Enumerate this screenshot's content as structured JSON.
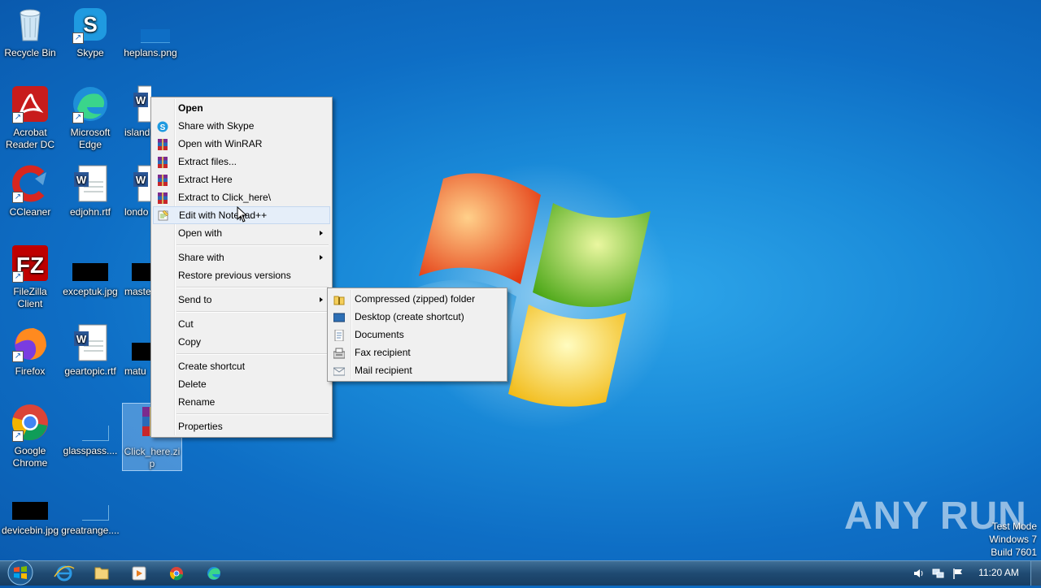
{
  "desktop": {
    "icons": [
      {
        "label": "Recycle Bin",
        "icon": "recycle-bin-icon"
      },
      {
        "label": "Skype",
        "icon": "skype-icon"
      },
      {
        "label": "heplans.png",
        "icon": "image-file-icon"
      },
      {
        "label": "Acrobat Reader DC",
        "icon": "acrobat-icon"
      },
      {
        "label": "Microsoft Edge",
        "icon": "edge-icon"
      },
      {
        "label": "island",
        "icon": "word-document-icon"
      },
      {
        "label": "CCleaner",
        "icon": "ccleaner-icon"
      },
      {
        "label": "edjohn.rtf",
        "icon": "word-document-icon"
      },
      {
        "label": "londo",
        "icon": "word-document-icon"
      },
      {
        "label": "FileZilla Client",
        "icon": "filezilla-icon"
      },
      {
        "label": "exceptuk.jpg",
        "icon": "image-file-icon"
      },
      {
        "label": "maste",
        "icon": "image-file-icon"
      },
      {
        "label": "Firefox",
        "icon": "firefox-icon"
      },
      {
        "label": "geartopic.rtf",
        "icon": "word-document-icon"
      },
      {
        "label": "matu",
        "icon": "image-file-icon"
      },
      {
        "label": "Google Chrome",
        "icon": "chrome-icon"
      },
      {
        "label": "glasspass....",
        "icon": "blank-file-icon"
      },
      {
        "label": "Click_here.zip",
        "icon": "winrar-archive-icon"
      },
      {
        "label": "devicebin.jpg",
        "icon": "image-file-icon"
      },
      {
        "label": "greatrange....",
        "icon": "blank-file-icon"
      }
    ]
  },
  "context_menu": {
    "items": [
      {
        "label": "Open",
        "icon": ""
      },
      {
        "label": "Share with Skype",
        "icon": "skype-icon"
      },
      {
        "label": "Open with WinRAR",
        "icon": "winrar-icon"
      },
      {
        "label": "Extract files...",
        "icon": "winrar-icon"
      },
      {
        "label": "Extract Here",
        "icon": "winrar-icon"
      },
      {
        "label": "Extract to Click_here\\",
        "icon": "winrar-icon"
      },
      {
        "label": "Edit with Notepad++",
        "icon": "notepad-plus-plus-icon"
      },
      {
        "label": "Open with",
        "icon": ""
      },
      {
        "label": "Share with",
        "icon": ""
      },
      {
        "label": "Restore previous versions",
        "icon": ""
      },
      {
        "label": "Send to",
        "icon": ""
      },
      {
        "label": "Cut",
        "icon": ""
      },
      {
        "label": "Copy",
        "icon": ""
      },
      {
        "label": "Create shortcut",
        "icon": ""
      },
      {
        "label": "Delete",
        "icon": ""
      },
      {
        "label": "Rename",
        "icon": ""
      },
      {
        "label": "Properties",
        "icon": ""
      }
    ]
  },
  "send_to_menu": {
    "items": [
      {
        "label": "Compressed (zipped) folder",
        "icon": "zip-folder-icon"
      },
      {
        "label": "Desktop (create shortcut)",
        "icon": "desktop-icon"
      },
      {
        "label": "Documents",
        "icon": "documents-icon"
      },
      {
        "label": "Fax recipient",
        "icon": "fax-icon"
      },
      {
        "label": "Mail recipient",
        "icon": "mail-icon"
      }
    ]
  },
  "watermark": {
    "text": "ANY RUN"
  },
  "test_mode": {
    "line1": "Test Mode",
    "line2": "Windows 7",
    "line3": "Build 7601"
  },
  "taskbar": {
    "clock": "11:20 AM",
    "pinned": [
      "start-orb-icon",
      "internet-explorer-icon",
      "explorer-folder-icon",
      "media-player-icon",
      "chrome-icon",
      "edge-icon"
    ],
    "tray": [
      "volume-icon",
      "network-icon",
      "flag-icon"
    ]
  }
}
